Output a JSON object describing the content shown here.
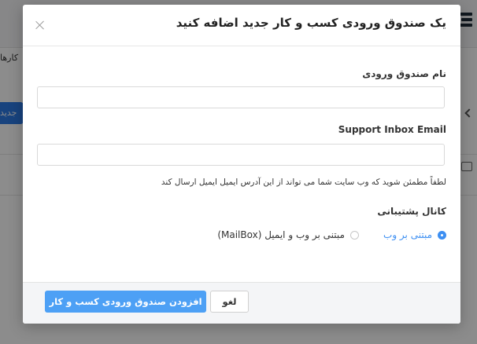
{
  "background": {
    "tab_label": "کارها",
    "button_label": "جدید"
  },
  "modal": {
    "title": "یک صندوق ورودی کسب و کار جدید اضافه کنید",
    "inbox_name_label": "نام صندوق ورودی",
    "inbox_name_value": "",
    "support_email_label": "Support Inbox Email",
    "support_email_value": "",
    "help_text": "لطفاً مطمئن شوید که وب سایت شما می تواند از این آدرس ایمیل ایمیل ارسال کند",
    "support_channel_label": "کانال پشتیبانی",
    "channel_options": [
      {
        "label": "مبتنی بر وب",
        "selected": true
      },
      {
        "label": "مبتنی بر وب و ایمیل (MailBox)",
        "selected": false
      }
    ],
    "submit_label": "افزودن صندوق ورودی کسب و کار",
    "cancel_label": "لغو"
  },
  "colors": {
    "accent": "#3d8ff2",
    "primary_button": "#4da0f5",
    "overlay": "rgba(0,0,0,0.45)"
  }
}
